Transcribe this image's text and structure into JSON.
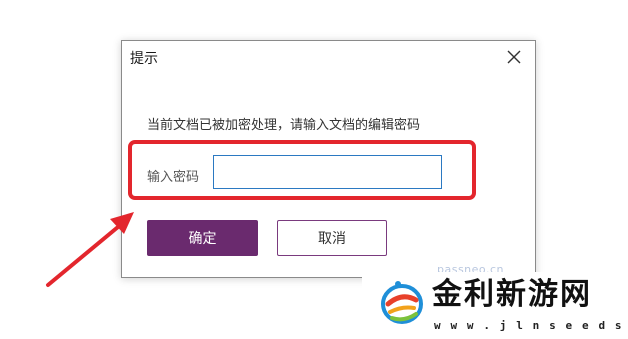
{
  "dialog": {
    "title": "提示",
    "message": "当前文档已被加密处理，请输入文档的编辑密码",
    "field_label": "输入密码",
    "password_value": "",
    "ok_label": "确定",
    "cancel_label": "取消",
    "faint_text": "passneo.cn"
  },
  "watermark": {
    "title": "金利新游网",
    "url": "w w w . j l n s e e d s . c o m"
  },
  "colors": {
    "accent": "#6a2a6e",
    "highlight": "#e3262d",
    "input_border": "#2b79c2"
  },
  "icons": {
    "close": "close-icon",
    "arrow": "arrow-annotation",
    "logo": "watermark-logo"
  }
}
